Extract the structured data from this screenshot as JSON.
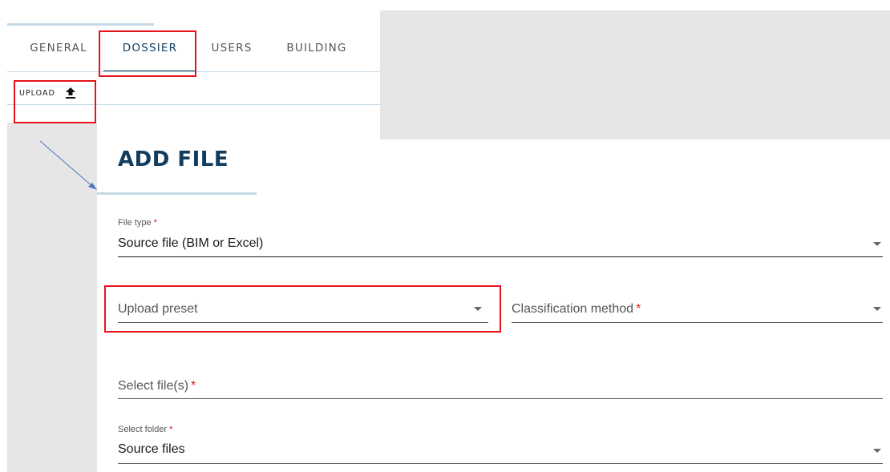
{
  "tabs": [
    {
      "label": "GENERAL"
    },
    {
      "label": "DOSSIER"
    },
    {
      "label": "USERS"
    },
    {
      "label": "BUILDING"
    }
  ],
  "active_tab": "DOSSIER",
  "toolbar": {
    "upload_label": "UPLOAD",
    "upload_icon": "upload-arrow-icon"
  },
  "dialog": {
    "title": "ADD FILE",
    "file_type": {
      "label": "File type",
      "required_mark": "*",
      "value": "Source file (BIM or Excel)"
    },
    "upload_preset": {
      "placeholder": "Upload preset"
    },
    "classification_method": {
      "placeholder": "Classification method",
      "required_mark": "*"
    },
    "select_files": {
      "placeholder": "Select file(s)",
      "required_mark": "*"
    },
    "select_folder": {
      "label": "Select folder",
      "required_mark": "*",
      "value": "Source files"
    }
  },
  "colors": {
    "brand_navy": "#113c5e",
    "accent_light_blue": "#c5d9e6",
    "highlight_red": "#e5141b",
    "required_red": "#d7191c",
    "panel_gray": "#e6e6e6"
  }
}
